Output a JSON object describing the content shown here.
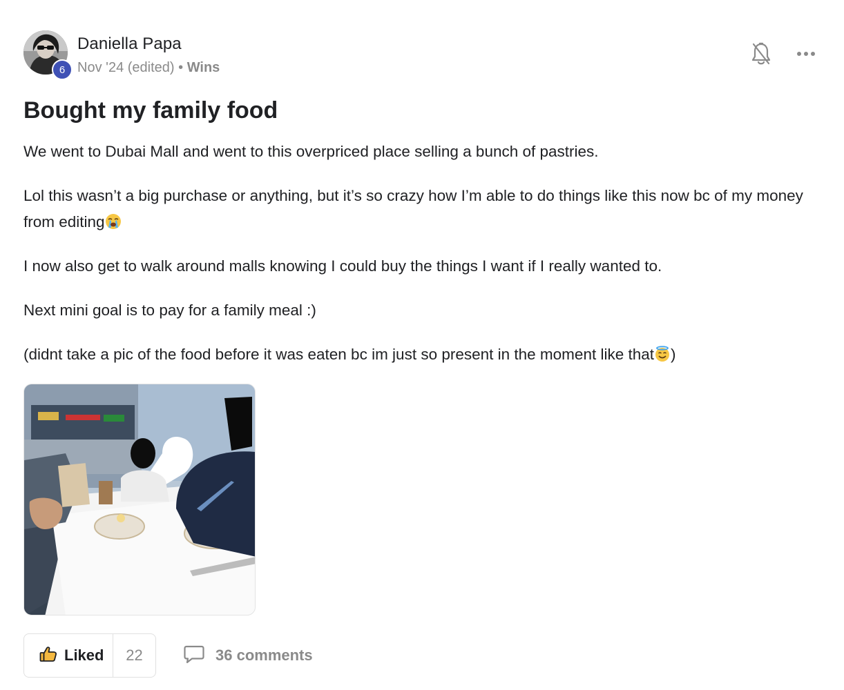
{
  "post": {
    "author": "Daniella Papa",
    "level": "6",
    "date": "Nov '24 (edited)",
    "separator": "•",
    "category": "Wins",
    "title": "Bought my family food",
    "paragraphs": [
      "We went to Dubai Mall and went to this overpriced place selling a bunch of pastries.",
      "Lol this wasn’t a big purchase or anything, but it’s so crazy how I’m able to do things like this now bc of my money from editing",
      "I now also get to walk around malls knowing I could buy the things I want if I really wanted to.",
      "Next mini goal is to pay for a family meal :)",
      "(didnt take a pic of the food before it was eaten bc im just so present in the moment like that",
      ")"
    ],
    "icons": {
      "bell": "bell-off-icon",
      "more": "more-horizontal-icon",
      "like": "thumbs-up-icon",
      "comment": "comment-bubble-icon",
      "emoji_crying": "loudly-crying-face-emoji",
      "emoji_halo": "smiling-face-with-halo-emoji"
    }
  },
  "actions": {
    "like_label": "Liked",
    "like_count": "22",
    "comments_label": "36 comments"
  },
  "colors": {
    "badge": "#3f51b5",
    "text": "#202124",
    "muted": "#8a8a8a",
    "border": "#e0e0e0"
  }
}
